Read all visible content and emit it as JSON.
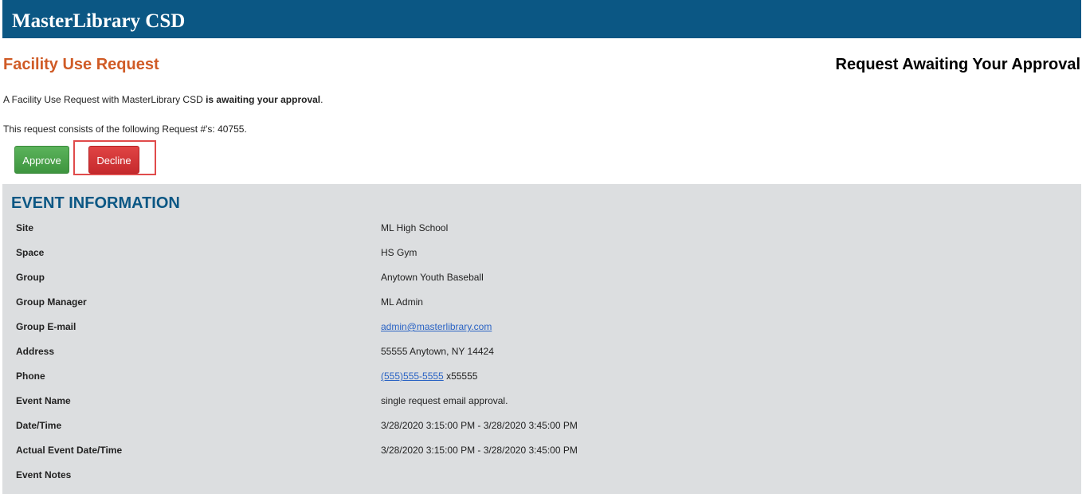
{
  "header": {
    "brand": "MasterLibrary CSD"
  },
  "page": {
    "title": "Facility Use Request",
    "status": "Request Awaiting Your Approval",
    "intro_prefix": "A Facility Use Request with MasterLibrary CSD ",
    "intro_bold": "is awaiting your approval",
    "intro_suffix": ".",
    "request_line": "This request consists of the following Request #'s: 40755."
  },
  "actions": {
    "approve_label": "Approve",
    "decline_label": "Decline"
  },
  "event": {
    "heading": "EVENT INFORMATION",
    "rows": [
      {
        "label": "Site",
        "value": "ML High School"
      },
      {
        "label": "Space",
        "value": "HS Gym"
      },
      {
        "label": "Group",
        "value": "Anytown Youth Baseball"
      },
      {
        "label": "Group Manager",
        "value": "ML Admin"
      },
      {
        "label": "Group E-mail",
        "value": "admin@masterlibrary.com"
      },
      {
        "label": "Address",
        "value": "55555 Anytown, NY 14424"
      },
      {
        "label": "Phone",
        "value": "(555)555-5555",
        "value_suffix": " x55555"
      },
      {
        "label": "Event Name",
        "value": "single request email approval."
      },
      {
        "label": "Date/Time",
        "value": "3/28/2020 3:15:00 PM - 3/28/2020 3:45:00 PM"
      },
      {
        "label": "Actual Event Date/Time",
        "value": "3/28/2020 3:15:00 PM - 3/28/2020 3:45:00 PM"
      },
      {
        "label": "Event Notes",
        "value": ""
      }
    ]
  },
  "colors": {
    "header_bg": "#0b5784",
    "title_orange": "#d05b26",
    "approve_green": "#3e953f",
    "decline_red": "#c62a2d",
    "panel_gray": "#dcdee0",
    "link_blue": "#2a63c4"
  }
}
